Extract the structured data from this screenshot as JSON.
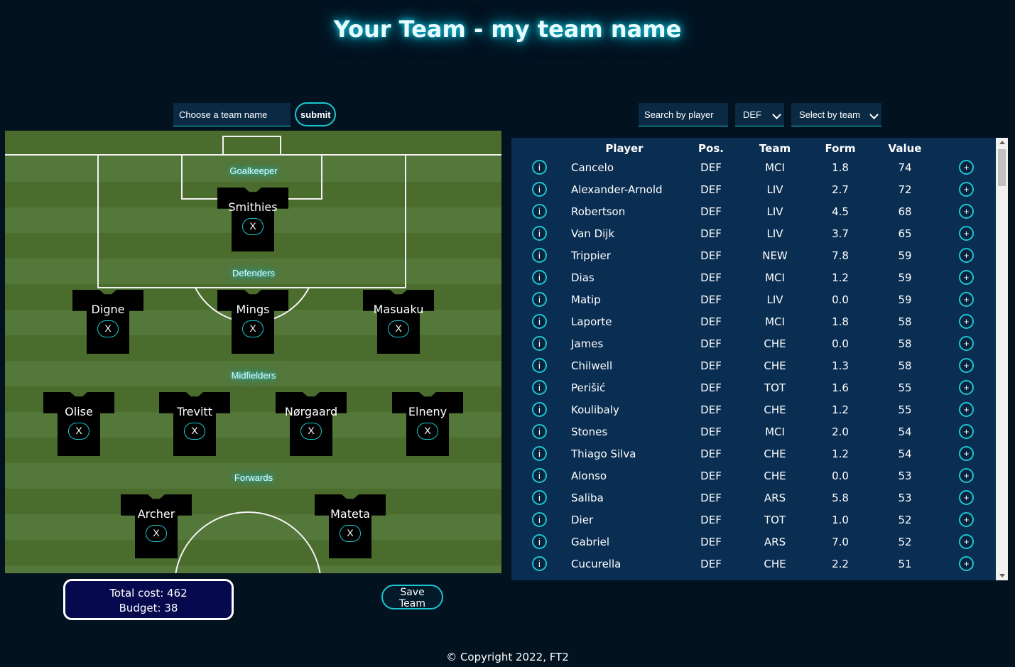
{
  "title": "Your Team - my team name",
  "team_form": {
    "placeholder": "Choose a team name",
    "submit_label": "submit"
  },
  "sections": {
    "goalkeeper": "Goalkeeper",
    "defenders": "Defenders",
    "midfielders": "Midfielders",
    "forwards": "Forwards"
  },
  "lineup": {
    "goalkeeper": [
      "Smithies"
    ],
    "defenders": [
      "Digne",
      "Mings",
      "Masuaku"
    ],
    "midfielders": [
      "Olise",
      "Trevitt",
      "Nørgaard",
      "Elneny"
    ],
    "forwards": [
      "Archer",
      "Mateta"
    ],
    "remove_label": "X"
  },
  "summary": {
    "total_cost": "Total cost: 462",
    "budget": "Budget: 38"
  },
  "save_label": "Save Team",
  "filters": {
    "search": "Search by player",
    "position": "DEF",
    "team": "Select by team"
  },
  "table": {
    "headers": [
      "Player",
      "Pos.",
      "Team",
      "Form",
      "Value"
    ],
    "info_label": "i",
    "add_label": "+",
    "rows": [
      {
        "player": "Cancelo",
        "pos": "DEF",
        "team": "MCI",
        "form": "1.8",
        "value": "74"
      },
      {
        "player": "Alexander-Arnold",
        "pos": "DEF",
        "team": "LIV",
        "form": "2.7",
        "value": "72"
      },
      {
        "player": "Robertson",
        "pos": "DEF",
        "team": "LIV",
        "form": "4.5",
        "value": "68"
      },
      {
        "player": "Van Dijk",
        "pos": "DEF",
        "team": "LIV",
        "form": "3.7",
        "value": "65"
      },
      {
        "player": "Trippier",
        "pos": "DEF",
        "team": "NEW",
        "form": "7.8",
        "value": "59"
      },
      {
        "player": "Dias",
        "pos": "DEF",
        "team": "MCI",
        "form": "1.2",
        "value": "59"
      },
      {
        "player": "Matip",
        "pos": "DEF",
        "team": "LIV",
        "form": "0.0",
        "value": "59"
      },
      {
        "player": "Laporte",
        "pos": "DEF",
        "team": "MCI",
        "form": "1.8",
        "value": "58"
      },
      {
        "player": "James",
        "pos": "DEF",
        "team": "CHE",
        "form": "0.0",
        "value": "58"
      },
      {
        "player": "Chilwell",
        "pos": "DEF",
        "team": "CHE",
        "form": "1.3",
        "value": "58"
      },
      {
        "player": "Perišić",
        "pos": "DEF",
        "team": "TOT",
        "form": "1.6",
        "value": "55"
      },
      {
        "player": "Koulibaly",
        "pos": "DEF",
        "team": "CHE",
        "form": "1.2",
        "value": "55"
      },
      {
        "player": "Stones",
        "pos": "DEF",
        "team": "MCI",
        "form": "2.0",
        "value": "54"
      },
      {
        "player": "Thiago Silva",
        "pos": "DEF",
        "team": "CHE",
        "form": "1.2",
        "value": "54"
      },
      {
        "player": "Alonso",
        "pos": "DEF",
        "team": "CHE",
        "form": "0.0",
        "value": "53"
      },
      {
        "player": "Saliba",
        "pos": "DEF",
        "team": "ARS",
        "form": "5.8",
        "value": "53"
      },
      {
        "player": "Dier",
        "pos": "DEF",
        "team": "TOT",
        "form": "1.0",
        "value": "52"
      },
      {
        "player": "Gabriel",
        "pos": "DEF",
        "team": "ARS",
        "form": "7.0",
        "value": "52"
      },
      {
        "player": "Cucurella",
        "pos": "DEF",
        "team": "CHE",
        "form": "2.2",
        "value": "51"
      }
    ]
  },
  "footer": "© Copyright 2022, FT2"
}
